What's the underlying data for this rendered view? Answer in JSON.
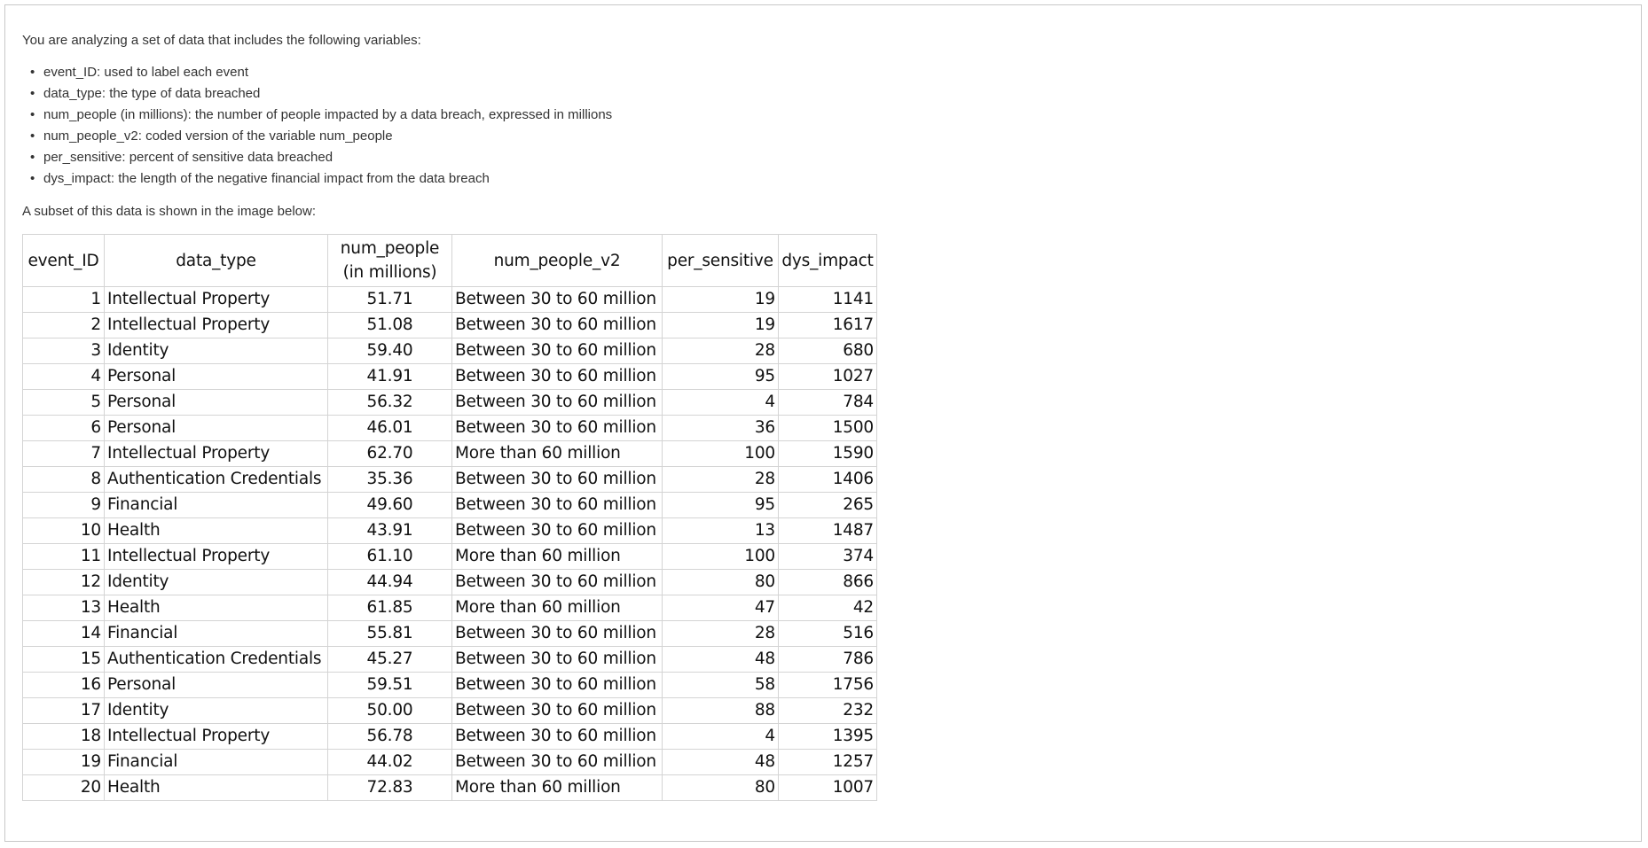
{
  "intro": "You are analyzing a set of data that includes the following variables:",
  "variables": [
    "event_ID: used to label each event",
    "data_type: the type of data breached",
    "num_people (in millions): the number of people impacted by a data breach, expressed in millions",
    "num_people_v2: coded version of the variable num_people",
    "per_sensitive: percent of sensitive data breached",
    "dys_impact: the length of the negative financial impact from the data breach"
  ],
  "subset_text": "A subset of this data is shown in the image below:",
  "table": {
    "headers": {
      "event_id": "event_ID",
      "data_type": "data_type",
      "num_people_line1": "num_people",
      "num_people_line2": "(in millions)",
      "num_people_v2": "num_people_v2",
      "per_sensitive": "per_sensitive",
      "dys_impact": "dys_impact"
    },
    "rows": [
      [
        "1",
        "Intellectual Property",
        "51.71",
        "Between 30 to 60 million",
        "19",
        "1141"
      ],
      [
        "2",
        "Intellectual Property",
        "51.08",
        "Between 30 to 60 million",
        "19",
        "1617"
      ],
      [
        "3",
        "Identity",
        "59.40",
        "Between 30 to 60 million",
        "28",
        "680"
      ],
      [
        "4",
        "Personal",
        "41.91",
        "Between 30 to 60 million",
        "95",
        "1027"
      ],
      [
        "5",
        "Personal",
        "56.32",
        "Between 30 to 60 million",
        "4",
        "784"
      ],
      [
        "6",
        "Personal",
        "46.01",
        "Between 30 to 60 million",
        "36",
        "1500"
      ],
      [
        "7",
        "Intellectual Property",
        "62.70",
        "More than 60 million",
        "100",
        "1590"
      ],
      [
        "8",
        "Authentication Credentials",
        "35.36",
        "Between 30 to 60 million",
        "28",
        "1406"
      ],
      [
        "9",
        "Financial",
        "49.60",
        "Between 30 to 60 million",
        "95",
        "265"
      ],
      [
        "10",
        "Health",
        "43.91",
        "Between 30 to 60 million",
        "13",
        "1487"
      ],
      [
        "11",
        "Intellectual Property",
        "61.10",
        "More than 60 million",
        "100",
        "374"
      ],
      [
        "12",
        "Identity",
        "44.94",
        "Between 30 to 60 million",
        "80",
        "866"
      ],
      [
        "13",
        "Health",
        "61.85",
        "More than 60 million",
        "47",
        "42"
      ],
      [
        "14",
        "Financial",
        "55.81",
        "Between 30 to 60 million",
        "28",
        "516"
      ],
      [
        "15",
        "Authentication Credentials",
        "45.27",
        "Between 30 to 60 million",
        "48",
        "786"
      ],
      [
        "16",
        "Personal",
        "59.51",
        "Between 30 to 60 million",
        "58",
        "1756"
      ],
      [
        "17",
        "Identity",
        "50.00",
        "Between 30 to 60 million",
        "88",
        "232"
      ],
      [
        "18",
        "Intellectual Property",
        "56.78",
        "Between 30 to 60 million",
        "4",
        "1395"
      ],
      [
        "19",
        "Financial",
        "44.02",
        "Between 30 to 60 million",
        "48",
        "1257"
      ],
      [
        "20",
        "Health",
        "72.83",
        "More than 60 million",
        "80",
        "1007"
      ]
    ]
  }
}
